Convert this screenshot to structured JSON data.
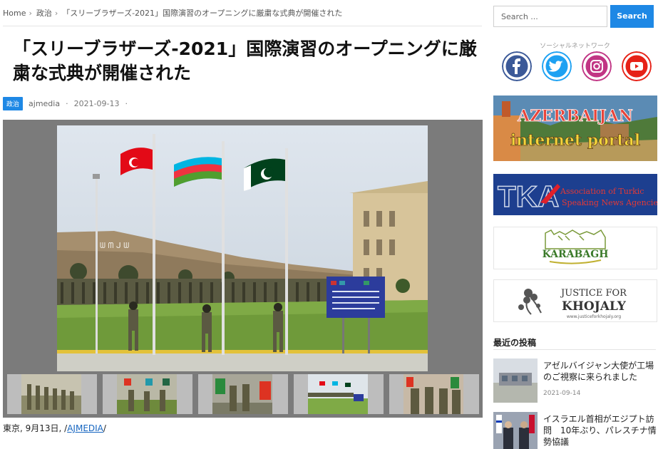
{
  "breadcrumb": {
    "home": "Home",
    "category": "政治",
    "current": "「スリーブラザーズ-2021」国際演習のオープニングに厳粛な式典が開催された"
  },
  "article": {
    "title": "「スリーブラザーズ-2021」国際演習のオープニングに厳粛な式典が開催された",
    "category_badge": "政治",
    "author": "ajmedia",
    "date": "2021-09-13",
    "caption_prefix": "東京, 9月13日, /",
    "caption_link": "AJMEDIA",
    "caption_suffix": "/"
  },
  "sidebar": {
    "search_placeholder": "Search ...",
    "search_button": "Search",
    "social_title": "ソーシャルネットワーク",
    "social_icons": [
      "facebook-icon",
      "twitter-icon",
      "instagram-icon",
      "youtube-icon"
    ],
    "social_colors": {
      "facebook": "#3b5998",
      "twitter": "#1da1f2",
      "instagram": "#c13584",
      "youtube": "#e62117"
    },
    "banners": {
      "azerbaijan_line1": "AZERBAIJAN",
      "azerbaijan_line2": "internet portal",
      "tka_logo": "TKA",
      "tka_line1": "Association of Turkic",
      "tka_line2": "Speaking News Agencies",
      "karabagh": "KARABAGH",
      "justice_line1": "JUSTICE FOR",
      "justice_line2": "KHOJALY",
      "justice_url": "www.justiceforkhojaly.org"
    },
    "recent_title": "最近の投稿",
    "recent_posts": [
      {
        "title": "アゼルバイジャン大使が工場のご視察に来られました",
        "date": "2021-09-14"
      },
      {
        "title": "イスラエル首相がエジプト訪問　10年ぶり、パレスチナ情勢協議",
        "date": ""
      }
    ]
  },
  "colors": {
    "accent": "#1e88e5",
    "gallery_bg": "#7b7b7b"
  }
}
